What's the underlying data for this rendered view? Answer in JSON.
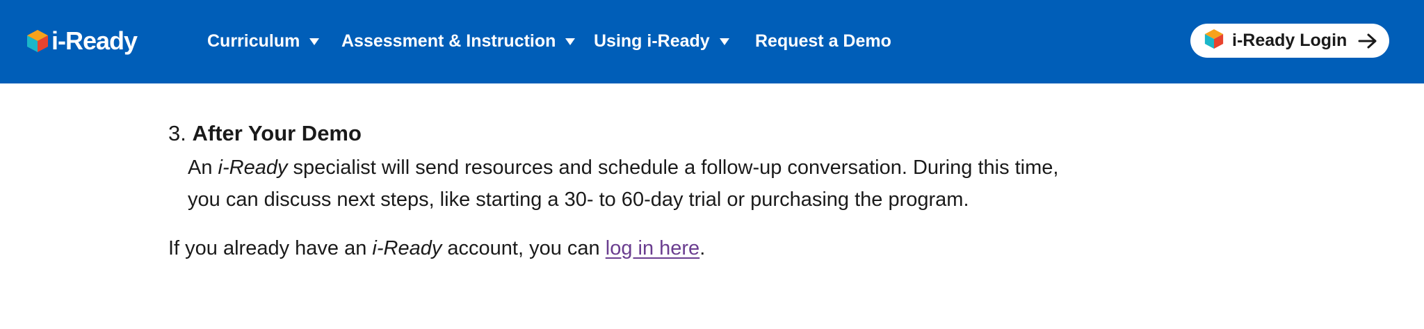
{
  "header": {
    "brand": "i-Ready",
    "nav": [
      {
        "label": "Curriculum",
        "has_dropdown": true
      },
      {
        "label": "Assessment & Instruction",
        "has_dropdown": true
      },
      {
        "label": "Using i-Ready",
        "has_dropdown": true
      },
      {
        "label": "Request a Demo",
        "has_dropdown": false
      }
    ],
    "login_label": "i-Ready Login",
    "icons": {
      "logo": "cube-logo-icon",
      "login": "cube-logo-icon",
      "arrow": "arrow-right-icon",
      "dropdown": "caret-down-icon"
    }
  },
  "content": {
    "step_number": "3.",
    "step_title": "After Your Demo",
    "step_body_prefix": "An",
    "step_body_emphasis": "i-Ready",
    "step_body_suffix": "specialist will send resources and schedule a follow-up conversation. During this time, you can discuss next steps, like starting a 30- to 60-day trial or purchasing the program.",
    "outro_prefix": "If you already have an",
    "outro_emphasis": "i-Ready",
    "outro_middle": "account, you can",
    "outro_link": "log in here",
    "outro_suffix": "."
  },
  "colors": {
    "header_bg": "#005eb8",
    "link": "#6a3d8f",
    "text": "#1a1a1a"
  }
}
